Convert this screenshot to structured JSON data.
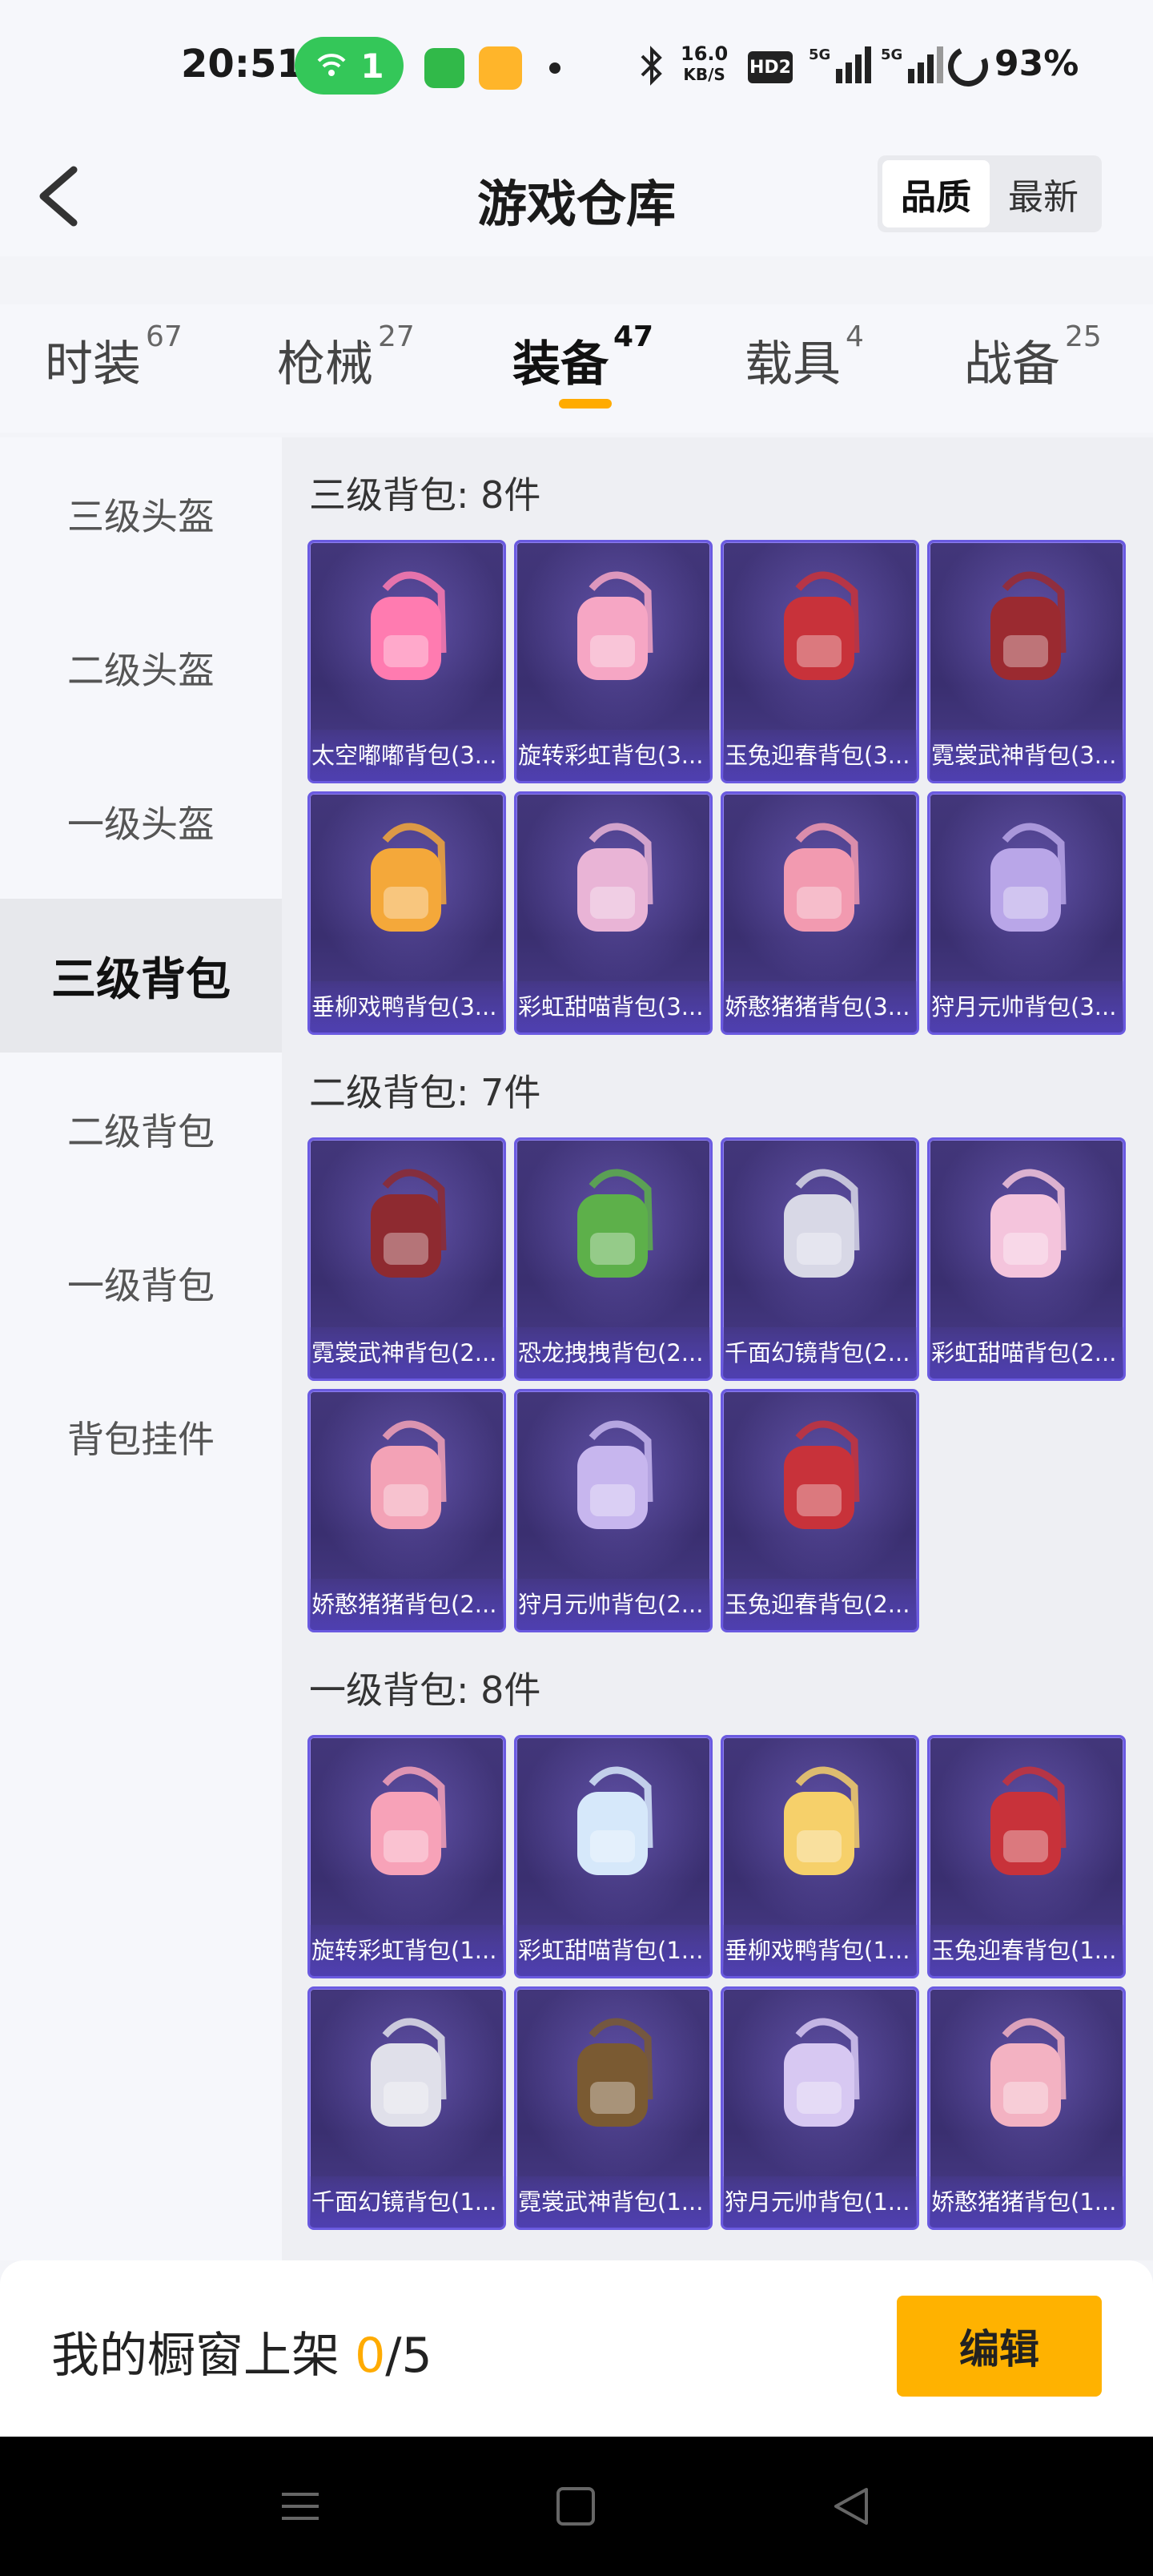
{
  "status_bar": {
    "time": "20:51",
    "wifi_badge": "1",
    "speed_top": "16.0",
    "speed_unit": "KB/S",
    "hd_label": "HD2",
    "sim1_label": "5G",
    "sim2_label": "5G",
    "battery": "93%",
    "icons": [
      "wifi-icon",
      "message-app-icon",
      "game-app-icon",
      "dot-icon",
      "bluetooth-icon",
      "signal-icon",
      "battery-icon"
    ]
  },
  "header": {
    "back_icon": "chevron-left-icon",
    "title": "游戏仓库",
    "sort_quality": "品质",
    "sort_newest": "最新"
  },
  "tabs": [
    {
      "label": "时装",
      "count": "67"
    },
    {
      "label": "枪械",
      "count": "27"
    },
    {
      "label": "装备",
      "count": "47"
    },
    {
      "label": "载具",
      "count": "4"
    },
    {
      "label": "战备",
      "count": "25"
    }
  ],
  "active_tab_color": "#ffab00",
  "sidebar": [
    {
      "label": "三级头盔"
    },
    {
      "label": "二级头盔"
    },
    {
      "label": "一级头盔"
    },
    {
      "label": "三级背包"
    },
    {
      "label": "二级背包"
    },
    {
      "label": "一级背包"
    },
    {
      "label": "背包挂件"
    }
  ],
  "sections": [
    {
      "title": "三级背包: 8件",
      "items": [
        {
          "name": "太空嘟嘟背包(3...",
          "color": "#ff7bb0"
        },
        {
          "name": "旋转彩虹背包(3...",
          "color": "#f6a6c4"
        },
        {
          "name": "玉兔迎春背包(3...",
          "color": "#c8323a"
        },
        {
          "name": "霓裳武神背包(3...",
          "color": "#9b2a30"
        },
        {
          "name": "垂柳戏鸭背包(3...",
          "color": "#f4a83a"
        },
        {
          "name": "彩虹甜喵背包(3...",
          "color": "#e9b4d6"
        },
        {
          "name": "娇憨猪猪背包(3...",
          "color": "#f29ab0"
        },
        {
          "name": "狩月元帅背包(3...",
          "color": "#b9a6e8"
        }
      ]
    },
    {
      "title": "二级背包: 7件",
      "items": [
        {
          "name": "霓裳武神背包(2...",
          "color": "#8e2a30"
        },
        {
          "name": "恐龙拽拽背包(2...",
          "color": "#5db04a"
        },
        {
          "name": "千面幻镜背包(2...",
          "color": "#d8d8e6"
        },
        {
          "name": "彩虹甜喵背包(2...",
          "color": "#f4c4dc"
        },
        {
          "name": "娇憨猪猪背包(2...",
          "color": "#f3a2b6"
        },
        {
          "name": "狩月元帅背包(2...",
          "color": "#c7b6ee"
        },
        {
          "name": "玉兔迎春背包(2...",
          "color": "#c8323a"
        }
      ]
    },
    {
      "title": "一级背包: 8件",
      "items": [
        {
          "name": "旋转彩虹背包(1...",
          "color": "#f7a2b8"
        },
        {
          "name": "彩虹甜喵背包(1...",
          "color": "#d6e8fa"
        },
        {
          "name": "垂柳戏鸭背包(1...",
          "color": "#f6d06a"
        },
        {
          "name": "玉兔迎春背包(1...",
          "color": "#c8323a"
        },
        {
          "name": "千面幻镜背包(1...",
          "color": "#e0e0ea"
        },
        {
          "name": "霓裳武神背包(1...",
          "color": "#7a5a32"
        },
        {
          "name": "狩月元帅背包(1...",
          "color": "#d7c8f2"
        },
        {
          "name": "娇憨猪猪背包(1...",
          "color": "#f3b2c2"
        }
      ]
    }
  ],
  "bottom": {
    "showcase_label": "我的橱窗上架 ",
    "showcase_count": "0",
    "showcase_total": "/5",
    "edit_label": "编辑"
  },
  "nav": {
    "icons": [
      "menu-icon",
      "home-icon",
      "back-triangle-icon"
    ]
  }
}
